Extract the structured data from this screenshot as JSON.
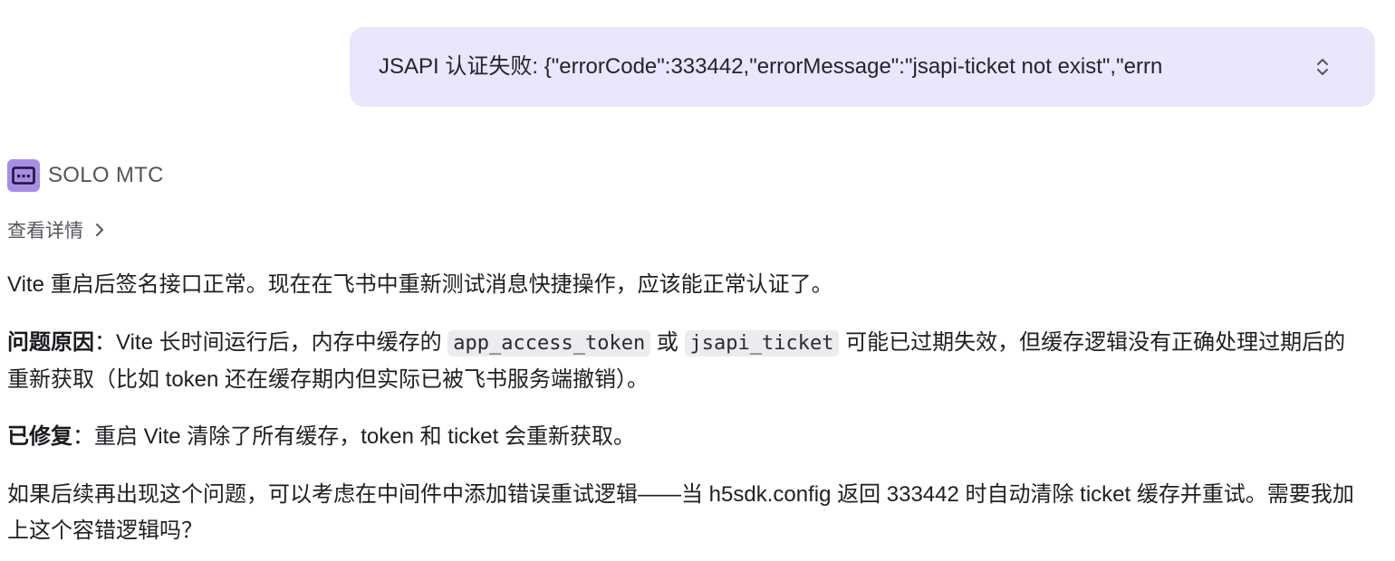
{
  "user_message": {
    "text": "JSAPI 认证失败: {\"errorCode\":333442,\"errorMessage\":\"jsapi-ticket not exist\",\"errn"
  },
  "assistant": {
    "name": "SOLO MTC",
    "avatar_icon": "terminal-bot-icon",
    "avatar_color": "#a98ce8",
    "details_label": "查看详情",
    "paragraphs": {
      "p1": "Vite 重启后签名接口正常。现在在飞书中重新测试消息快捷操作，应该能正常认证了。",
      "p2_label": "问题原因",
      "p2_colon": "：",
      "p2_a": "Vite 长时间运行后，内存中缓存的 ",
      "p2_code1": "app_access_token",
      "p2_b": " 或 ",
      "p2_code2": "jsapi_ticket",
      "p2_c": " 可能已过期失效，但缓存逻辑没有正确处理过期后的重新获取（比如 token 还在缓存期内但实际已被飞书服务端撤销）。",
      "p3_label": "已修复",
      "p3_colon": "：",
      "p3_text": "重启 Vite 清除了所有缓存，token 和 ticket 会重新获取。",
      "p4": "如果后续再出现这个问题，可以考虑在中间件中添加错误重试逻辑——当 h5sdk.config 返回 333442 时自动清除 ticket 缓存并重试。需要我加上这个容错逻辑吗？"
    }
  },
  "colors": {
    "bubble_bg": "#e8e7fb",
    "code_bg": "#ececef",
    "text": "#1f1f24"
  }
}
